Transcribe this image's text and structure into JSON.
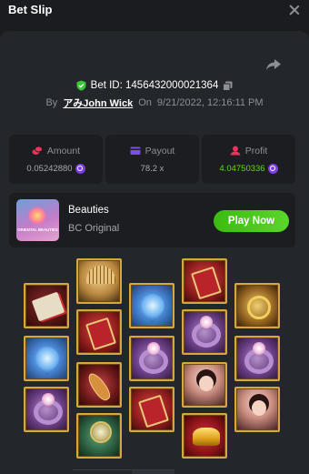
{
  "header": {
    "title": "Bet Slip"
  },
  "bet": {
    "bet_id_label": "Bet ID: 1456432000021364",
    "by_label": "By",
    "username": "アみJohn Wick",
    "on_label": "On",
    "datetime": "9/21/2022, 12:16:11 PM"
  },
  "stats": {
    "amount": {
      "label": "Amount",
      "value": "0.05242880",
      "icon": "coins-icon"
    },
    "payout": {
      "label": "Payout",
      "value": "78.2 x",
      "icon": "wallet-icon"
    },
    "profit": {
      "label": "Profit",
      "value": "4.04750336",
      "icon": "profit-icon"
    }
  },
  "game": {
    "name": "Beauties",
    "provider": "BC Original",
    "thumb_text": "ORIENTAL BEAUTIES",
    "play_label": "Play Now"
  },
  "colors": {
    "background": "#1a1c20",
    "panel": "#23262b",
    "card": "#1b1d21",
    "accent_green": "#5ddb1c",
    "coin_purple": "#7b3fe4",
    "amount_icon": "#e8345a",
    "payout_icon": "#7b4fe0",
    "profit_icon": "#e8345a"
  },
  "reels": [
    [
      "scroll-symbol",
      "lotus-symbol",
      "ring-symbol"
    ],
    [
      "fan-symbol",
      "book-symbol",
      "pipa-symbol",
      "mirror-symbol"
    ],
    [
      "lotus-symbol",
      "ring-symbol",
      "book-symbol"
    ],
    [
      "book-symbol",
      "ring-symbol",
      "girl-symbol",
      "gold-symbol"
    ],
    [
      "pendant-symbol",
      "ring-symbol",
      "girl-symbol"
    ]
  ]
}
